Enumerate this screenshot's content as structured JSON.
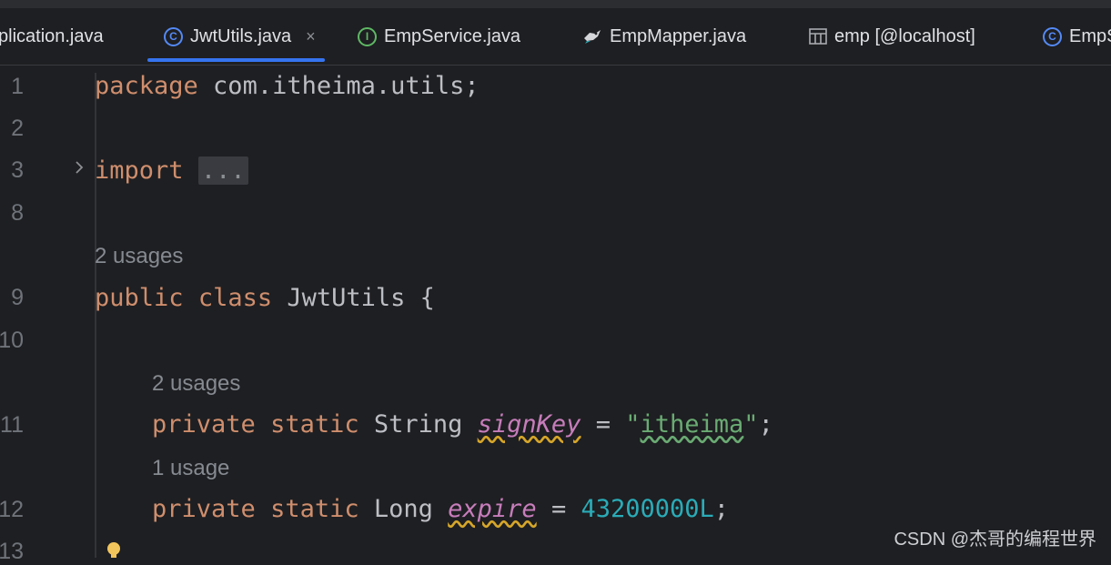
{
  "tabs": [
    {
      "label": "plication.java",
      "icon": "spring-class-icon"
    },
    {
      "label": "JwtUtils.java",
      "icon": "class-icon",
      "close": "×"
    },
    {
      "label": "EmpService.java",
      "icon": "interface-icon"
    },
    {
      "label": "EmpMapper.java",
      "icon": "mybatis-bird-icon"
    },
    {
      "label": "emp [@localhost]",
      "icon": "table-icon"
    },
    {
      "label": "EmpS",
      "icon": "class-icon"
    }
  ],
  "icon_glyphs": {
    "class": "C",
    "interface": "I"
  },
  "editor": {
    "line_numbers": [
      "1",
      "2",
      "3",
      "8",
      "9",
      "10",
      "11",
      "12",
      "13"
    ],
    "line1": {
      "kw": "package",
      "rest": " com.itheima.utils;"
    },
    "line3": {
      "kw": "import",
      "folded": "..."
    },
    "hint_class": "2 usages",
    "line9": {
      "kw1": "public",
      "kw2": "class",
      "rest": " JwtUtils {"
    },
    "hint_signkey": "2 usages",
    "line11": {
      "kw1": "private",
      "kw2": "static",
      "type": " String ",
      "field": "signKey",
      "eq": " = ",
      "q1": "\"",
      "str": "itheima",
      "q2": "\"",
      "end": ";"
    },
    "hint_expire": "1 usage",
    "line12": {
      "kw1": "private",
      "kw2": "static",
      "type": " Long ",
      "field": "expire",
      "eq": " = ",
      "num": "43200000L",
      "end": ";"
    }
  },
  "watermark": "CSDN @杰哥的编程世界",
  "colors": {
    "accent": "#3574f0",
    "keyword": "#cf8e6d",
    "string": "#6aab73",
    "number": "#2aacb8",
    "field": "#c77dbb",
    "background": "#1e1f22"
  }
}
